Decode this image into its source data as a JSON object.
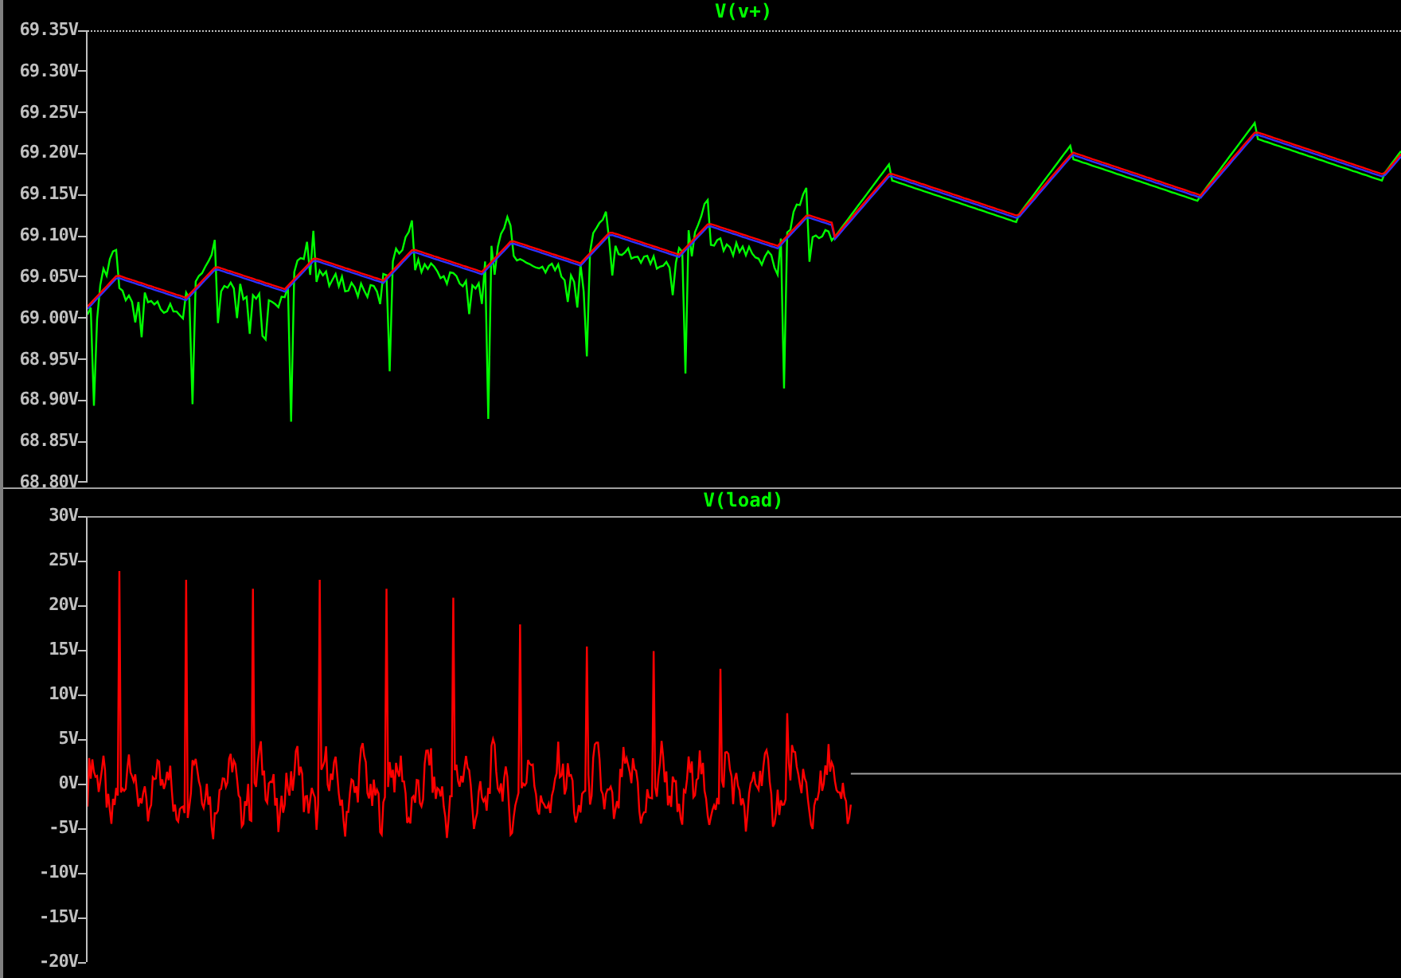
{
  "panes": [
    {
      "kind": "ripple",
      "title": "V(v+)",
      "y_ticks": [
        "69.35V",
        "69.30V",
        "69.25V",
        "69.20V",
        "69.15V",
        "69.10V",
        "69.05V",
        "69.00V",
        "68.95V",
        "68.90V",
        "68.85V",
        "68.80V"
      ]
    },
    {
      "kind": "pulses",
      "title": "V(load)",
      "y_ticks": [
        "30V",
        "25V",
        "20V",
        "15V",
        "10V",
        "5V",
        "0V",
        "-5V",
        "-10V",
        "-15V",
        "-20V"
      ]
    }
  ]
}
